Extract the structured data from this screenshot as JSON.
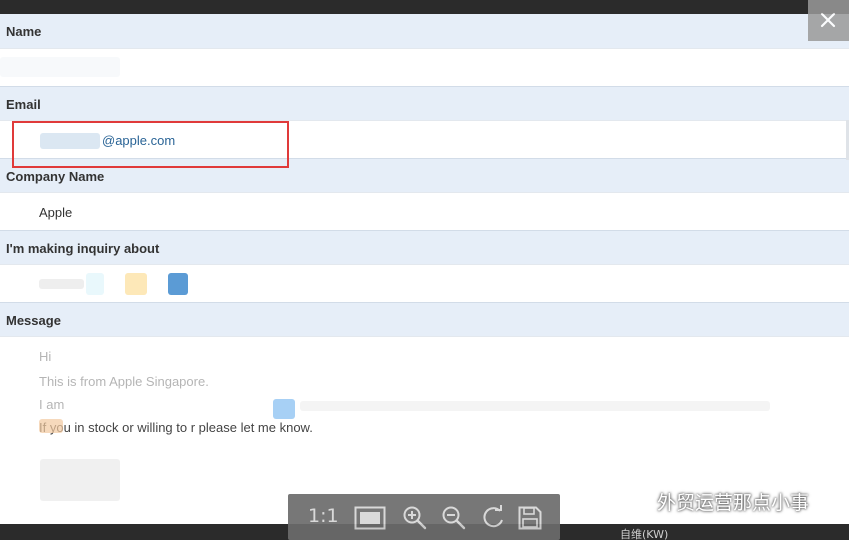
{
  "form": {
    "name_label": "Name",
    "name_value": "",
    "email_label": "Email",
    "email_value": "@apple.com",
    "company_label": "Company Name",
    "company_value": "Apple",
    "inquiry_label": "I'm making inquiry about",
    "message_label": "Message",
    "message_lines": [
      "Hi",
      "This is        from Apple Singapore.",
      "I am",
      "If you        in stock or willing to r         please let me know."
    ]
  },
  "viewer": {
    "ratio_label": "1:1",
    "tools": [
      "fit-screen-icon",
      "zoom-in-icon",
      "zoom-out-icon",
      "rotate-icon",
      "save-icon"
    ]
  },
  "watermark": {
    "text": "外贸运营那点小事"
  },
  "taskbar": {
    "peek_text": "自维(KW)"
  },
  "colors": {
    "header_bg": "#e6eef8",
    "highlight": "#e03a3a",
    "link": "#2a6496",
    "toolbar_bg": "#6c6c6c"
  }
}
